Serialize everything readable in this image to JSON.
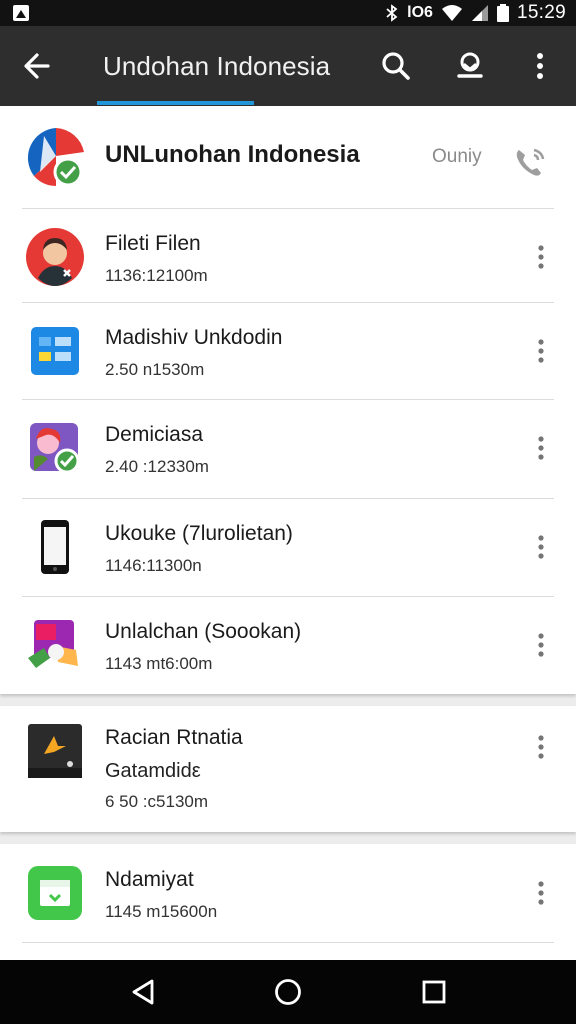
{
  "status_bar": {
    "carrier": "lO6",
    "time": "15:29"
  },
  "app_bar": {
    "title": "Undohan Indonesia",
    "icons": [
      "back-arrow-icon",
      "search-icon",
      "profile-badge-icon",
      "more-vert-icon"
    ],
    "accent_color": "#2196d8"
  },
  "header": {
    "name": "UNLunohan Indonesia",
    "label": "Ouniy",
    "icons": [
      "app-logo-icon",
      "call-icon"
    ]
  },
  "items": [
    {
      "title": "Fileti Filen",
      "subtitle": "1136:12100m",
      "icon": "avatar-icon"
    },
    {
      "title": "Madishiv Unkdodin",
      "subtitle": "2.50 n1530m",
      "icon": "blue-app-icon"
    },
    {
      "title": "Demiciasa",
      "subtitle": "2.40 :12330m",
      "icon": "purple-app-icon"
    },
    {
      "title": "Ukouke (7lurolietan)",
      "subtitle": "1146:11300n",
      "icon": "phone-device-icon"
    },
    {
      "title": "Unlalchan (Soookan)",
      "subtitle": "1143 mt6:00m",
      "icon": "colorful-app-icon"
    }
  ],
  "card2": {
    "title": "Racian Rtnatia",
    "line2": "Gatamdidε",
    "line3": "6 50 :c5130m",
    "icon": "dark-app-icon"
  },
  "card3": {
    "title": "Ndamiyat",
    "subtitle": "1145 m15600n",
    "icon": "green-app-icon"
  },
  "nav_bar": {
    "icons": [
      "nav-back-icon",
      "nav-home-icon",
      "nav-recents-icon"
    ]
  }
}
